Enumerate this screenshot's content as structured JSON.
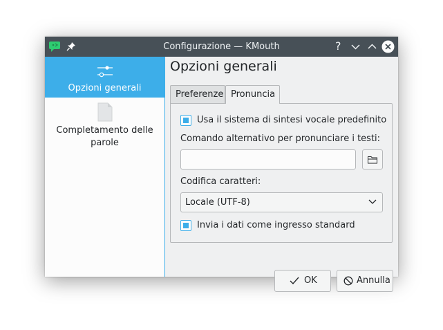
{
  "window": {
    "title": "Configurazione — KMouth",
    "icons": {
      "app": "kmouth-chat-icon",
      "pin": "pin-icon"
    },
    "controls": [
      "help-icon",
      "minimize-icon",
      "maximize-icon",
      "close-icon"
    ],
    "help_glyph": "?"
  },
  "sidebar": {
    "items": [
      {
        "label": "Opzioni generali",
        "icon": "sliders-icon",
        "selected": true
      },
      {
        "label": "Completamento delle parole",
        "icon": "document-icon",
        "selected": false
      }
    ]
  },
  "page": {
    "title": "Opzioni generali",
    "tabs": [
      {
        "label": "Preferenze",
        "active": false
      },
      {
        "label": "Pronuncia",
        "active": true
      }
    ],
    "use_default_synth": {
      "label": "Usa il sistema di sintesi vocale predefinito",
      "checked": true
    },
    "alt_command": {
      "label": "Comando alternativo per pronunciare i testi:",
      "value": "",
      "browse_icon": "folder-icon"
    },
    "encoding": {
      "label": "Codifica caratteri:",
      "selected": "Locale (UTF-8)"
    },
    "stdin": {
      "label": "Invia i dati come ingresso standard",
      "checked": true
    }
  },
  "buttons": {
    "ok": {
      "label": "OK",
      "icon": "check-icon"
    },
    "cancel": {
      "label": "Annulla",
      "icon": "cancel-icon"
    }
  },
  "colors": {
    "accent": "#3daee9",
    "titlebar": "#475057",
    "window_bg": "#eff0f1"
  }
}
